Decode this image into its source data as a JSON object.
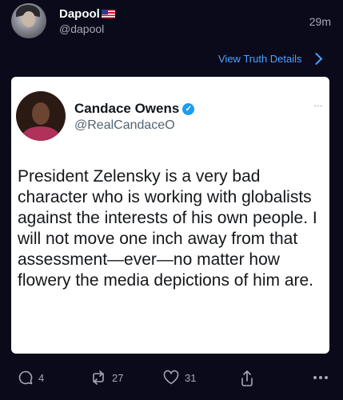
{
  "post": {
    "author_name": "Dapool",
    "author_handle": "@dapool",
    "timestamp": "29m",
    "flag_icon": "us-flag-icon",
    "view_details_label": "View Truth Details"
  },
  "embed": {
    "author_name": "Candace Owens",
    "author_handle": "@RealCandaceO",
    "verified_icon": "verified-check-icon",
    "text": "President Zelensky is a very bad character who is working with globalists against the interests of his own people. I will not move one inch away from that assessment—ever—no matter how flowery the media depictions of him are."
  },
  "actions": {
    "replies": "4",
    "retruths": "27",
    "likes": "31"
  },
  "colors": {
    "background": "#0b0a1a",
    "accent": "#4aa3ff",
    "muted": "#a8a8b3",
    "verified": "#1d9bf0"
  }
}
